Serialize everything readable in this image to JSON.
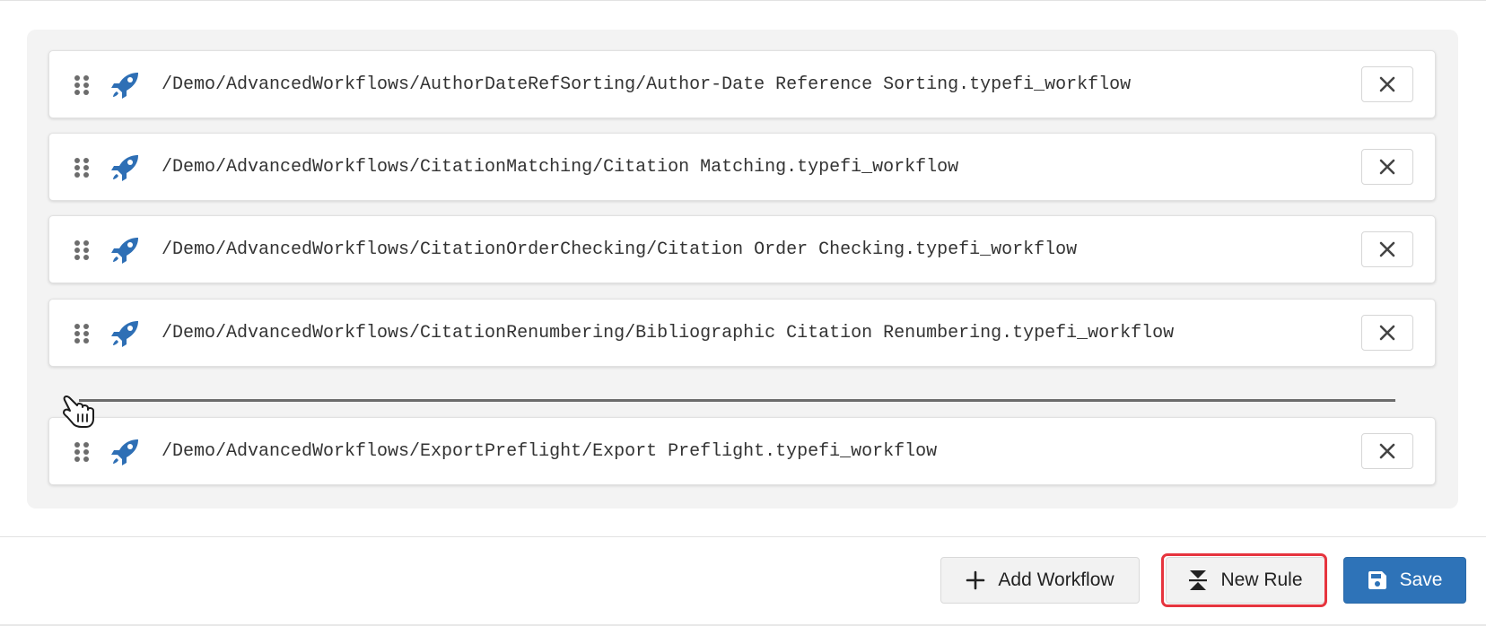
{
  "workflows": [
    {
      "path": "/Demo/AdvancedWorkflows/AuthorDateRefSorting/Author-Date Reference Sorting.typefi_workflow"
    },
    {
      "path": "/Demo/AdvancedWorkflows/CitationMatching/Citation Matching.typefi_workflow"
    },
    {
      "path": "/Demo/AdvancedWorkflows/CitationOrderChecking/Citation Order Checking.typefi_workflow"
    },
    {
      "path": "/Demo/AdvancedWorkflows/CitationRenumbering/Bibliographic Citation Renumbering.typefi_workflow"
    },
    {
      "path": "/Demo/AdvancedWorkflows/ExportPreflight/Export Preflight.typefi_workflow"
    }
  ],
  "icons": {
    "drag": "drag-handle-icon",
    "workflow": "rocket-icon",
    "remove": "close-icon",
    "add": "plus-icon",
    "new_rule": "page-break-icon",
    "save": "floppy-disk-icon",
    "cursor": "grab-hand-cursor-icon"
  },
  "colors": {
    "accent": "#2e73b8",
    "rocket": "#2e6fb5",
    "focus_ring": "#e6343e",
    "panel_bg": "#f3f3f3"
  },
  "footer": {
    "add_workflow_label": "Add Workflow",
    "new_rule_label": "New Rule",
    "save_label": "Save"
  }
}
